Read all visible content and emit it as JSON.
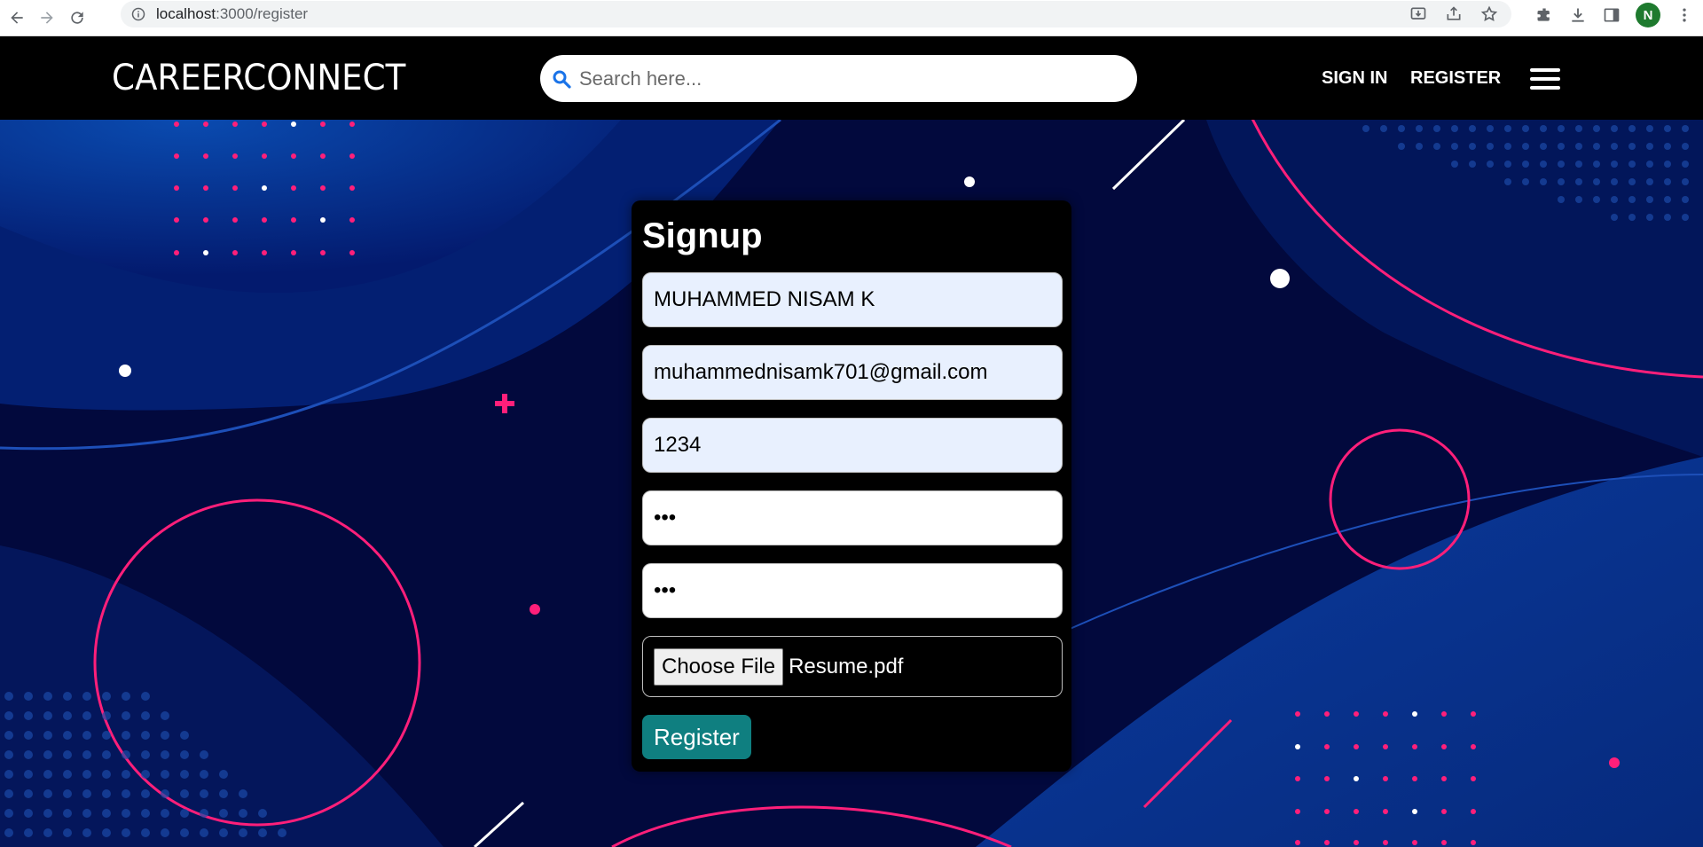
{
  "browser": {
    "url_host": "localhost",
    "url_path": ":3000/register",
    "profile_initial": "N"
  },
  "header": {
    "brand": "CAREERCONNECT",
    "search_placeholder": "Search here...",
    "nav": {
      "signin": "SIGN IN",
      "register": "REGISTER"
    }
  },
  "form": {
    "title": "Signup",
    "fields": {
      "name": "MUHAMMED NISAM K",
      "email": "muhammednisamk701@gmail.com",
      "phone": "1234",
      "password": "•••",
      "confirm_password": "•••"
    },
    "file_button": "Choose File",
    "file_name": "Resume.pdf",
    "submit": "Register"
  },
  "colors": {
    "header_bg": "#000000",
    "page_bg": "#02093d",
    "accent_pink": "#ff1f7a",
    "autofill_bg": "#e8f0fe",
    "submit_bg": "#0f7f80",
    "search_icon": "#1a73e8"
  },
  "icons": [
    "back-icon",
    "forward-icon",
    "reload-icon",
    "info-icon",
    "install-icon",
    "share-icon",
    "star-icon",
    "extensions-icon",
    "download-icon",
    "sidepanel-icon",
    "menu-dots-icon",
    "search-icon",
    "hamburger-icon"
  ]
}
